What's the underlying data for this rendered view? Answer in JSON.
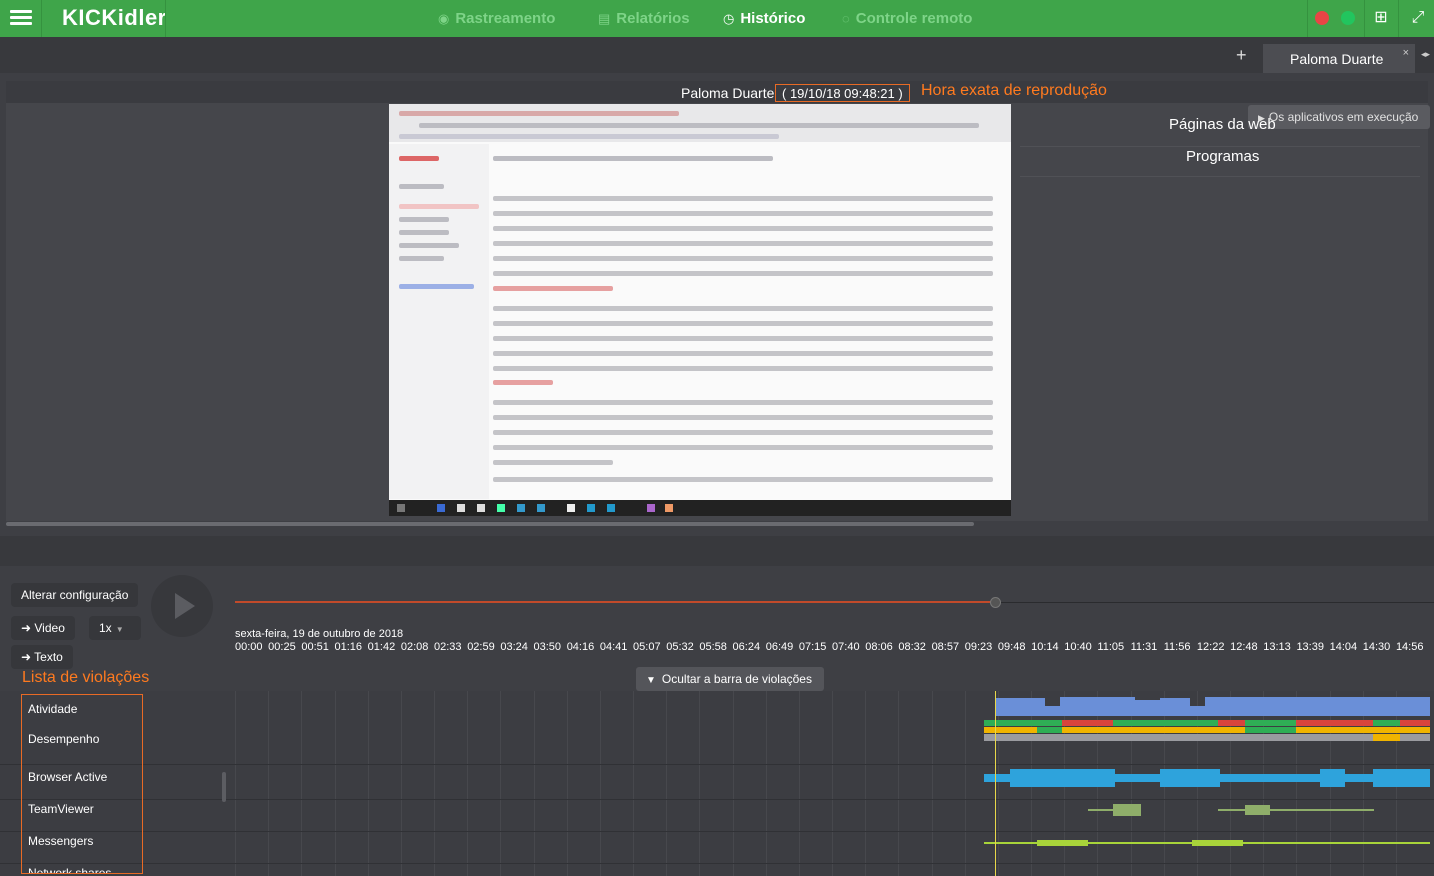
{
  "app": {
    "logo": "KICKidler",
    "nav": [
      {
        "label": "Rastreamento",
        "icon": "eye-icon"
      },
      {
        "label": "Relatórios",
        "icon": "document-icon"
      },
      {
        "label": "Histórico",
        "icon": "history-icon"
      },
      {
        "label": "Controle remoto",
        "icon": "remote-icon"
      }
    ],
    "active_nav": "Histórico"
  },
  "tabs": {
    "add": "+",
    "items": [
      {
        "label": "Paloma Duarte",
        "close": "×"
      }
    ]
  },
  "player": {
    "user": "Paloma Duarte",
    "timestamp": "( 19/10/18 09:48:21 )",
    "annotation": "Hora exata de reprodução"
  },
  "side_panel": {
    "toggle_label": "Os aplicativos em execução",
    "web_pages": "Páginas da web",
    "programs": "Programas"
  },
  "controls": {
    "config_button": "Alterar configuração",
    "video_button": "Video",
    "speed": "1x",
    "text_button": "Texto"
  },
  "timeline": {
    "date": "sexta-feira, 19 de outubro de 2018",
    "ticks": [
      "00:00",
      "00:25",
      "00:51",
      "01:16",
      "01:42",
      "02:08",
      "02:33",
      "02:59",
      "03:24",
      "03:50",
      "04:16",
      "04:41",
      "05:07",
      "05:32",
      "05:58",
      "06:24",
      "06:49",
      "07:15",
      "07:40",
      "08:06",
      "08:32",
      "08:57",
      "09:23",
      "09:48",
      "10:14",
      "10:40",
      "11:05",
      "11:31",
      "11:56",
      "12:22",
      "12:48",
      "13:13",
      "13:39",
      "14:04",
      "14:30",
      "14:56"
    ],
    "position": 0.65
  },
  "violations": {
    "title": "Lista de violações",
    "hide_button": "Ocultar a barra de violações",
    "items": [
      "Atividade",
      "Desempenho",
      "Browser Active",
      "TeamViewer",
      "Messengers",
      "Network shares"
    ]
  },
  "colors": {
    "brand": "#3fa54a",
    "accent": "#ff7a1f",
    "activity": "#6a8fd8",
    "browser": "#2ea3dc",
    "teamviewer": "#8fae6a",
    "messengers": "#a8d43a"
  }
}
